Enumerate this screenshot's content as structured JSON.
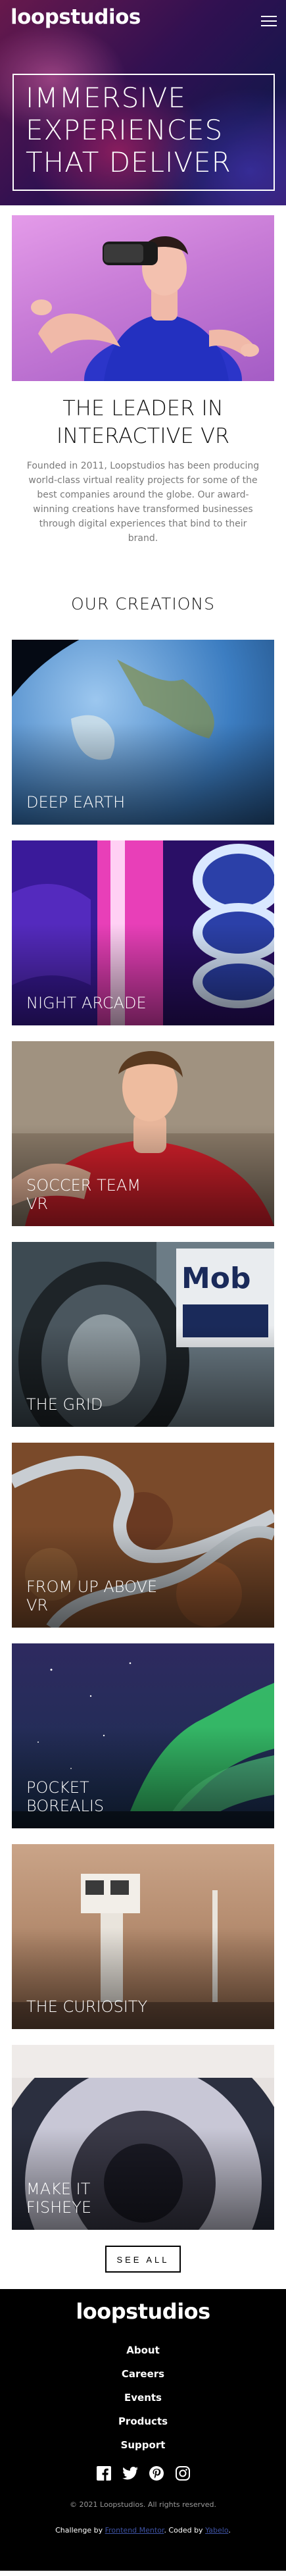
{
  "header": {
    "logo": "loopstudios",
    "hero_title": "IMMERSIVE EXPERIENCES THAT DELIVER"
  },
  "intro": {
    "title": "THE LEADER IN INTERACTIVE VR",
    "text": "Founded in 2011, Loopstudios has been producing world-class virtual reality projects for some of the best companies around the globe. Our award-winning creations have transformed businesses through digital experiences that bind to their brand."
  },
  "creations": {
    "title": "OUR CREATIONS",
    "items": [
      {
        "label": "DEEP EARTH"
      },
      {
        "label": "NIGHT ARCADE"
      },
      {
        "label": "SOCCER TEAM VR"
      },
      {
        "label": "THE GRID"
      },
      {
        "label": "FROM UP ABOVE VR"
      },
      {
        "label": "POCKET BOREALIS"
      },
      {
        "label": "THE CURIOSITY"
      },
      {
        "label": "MAKE IT FISHEYE"
      }
    ],
    "see_all": "SEE ALL"
  },
  "footer": {
    "logo": "loopstudios",
    "nav": [
      "About",
      "Careers",
      "Events",
      "Products",
      "Support"
    ],
    "socials": [
      "facebook-icon",
      "twitter-icon",
      "pinterest-icon",
      "instagram-icon"
    ],
    "copyright": "© 2021 Loopstudios. All rights reserved.",
    "attribution_prefix": "Challenge by",
    "attribution_link1": "Frontend Mentor",
    "attribution_middle": ". Coded by",
    "attribution_link2": "Yabelo"
  }
}
